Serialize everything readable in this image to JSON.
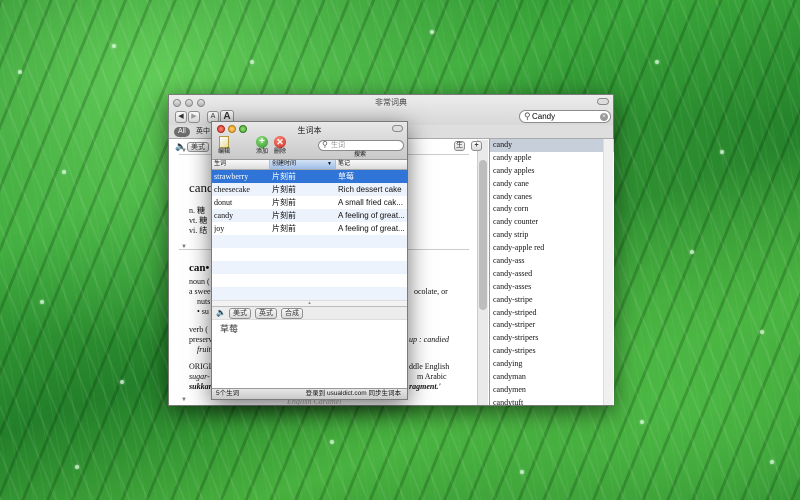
{
  "main_window": {
    "title": "非常词典",
    "search": {
      "value": "Candy",
      "placeholder": ""
    },
    "font_small_label": "A",
    "font_large_label": "A",
    "tabs": [
      {
        "label": "All"
      },
      {
        "label": "英中"
      }
    ],
    "speaker_label": "美式",
    "plus_label": "+",
    "side_button_label": "生",
    "entry_partial": {
      "headword1": "cand",
      "senses1": [
        "n. 糖",
        "vt. 糖",
        "vi. 结"
      ],
      "headword2": "can•",
      "noun_label": "noun (",
      "noun_line1": "a swee",
      "noun_right1": "ocolate, or",
      "noun_nuts": "nuts",
      "noun_bullet": "• su",
      "verb_label": "verb (",
      "verb_preserv": "preserv",
      "verb_fruit": "fruit",
      "verb_right": "up : candied",
      "origin_label": "ORIGI",
      "origin_sugar": "sugar-",
      "origin_sukkar": "sukkar",
      "origin_right1": "ddle English",
      "origin_right2": "m Arabic",
      "origin_right3": "ragment.'",
      "footer_section": "English Caramel"
    },
    "word_list": [
      "candy",
      "candy apple",
      "candy apples",
      "candy cane",
      "candy canes",
      "candy corn",
      "candy counter",
      "candy strip",
      "candy-apple red",
      "candy-ass",
      "candy-assed",
      "candy-asses",
      "candy-stripe",
      "candy-striped",
      "candy-striper",
      "candy-stripers",
      "candy-stripes",
      "candying",
      "candyman",
      "candymen",
      "candytuft"
    ],
    "selected_word_index": 0
  },
  "notebook": {
    "title": "生词本",
    "toolbar": {
      "edit": "编辑",
      "add": "添加",
      "delete": "删除",
      "search_label": "搜索",
      "search_placeholder": "生词"
    },
    "columns": [
      "生词",
      "创建时间",
      "笔记"
    ],
    "rows": [
      {
        "word": "strawberry",
        "time": "片刻前",
        "note": "草莓"
      },
      {
        "word": "cheesecake",
        "time": "片刻前",
        "note": "Rich dessert cake"
      },
      {
        "word": "donut",
        "time": "片刻前",
        "note": "A small fried cak..."
      },
      {
        "word": "candy",
        "time": "片刻前",
        "note": "A feeling of great..."
      },
      {
        "word": "joy",
        "time": "片刻前",
        "note": "A feeling of great..."
      }
    ],
    "selected_row": 0,
    "detail_buttons": [
      "美式",
      "英式",
      "合成"
    ],
    "detail_text": "草莓",
    "status_count": "5个生词",
    "status_sync": "登录到 usualdict.com 同步生词本"
  },
  "colors": {
    "selection": "#2f74d6",
    "list_selection": "#c7cfdb",
    "add": "#3aa13a",
    "delete": "#d3382c"
  },
  "icons": [
    "speaker-icon",
    "search-icon",
    "clear-icon",
    "pencil-icon",
    "plus-icon",
    "delete-icon",
    "back-arrow-icon",
    "forward-arrow-icon"
  ]
}
